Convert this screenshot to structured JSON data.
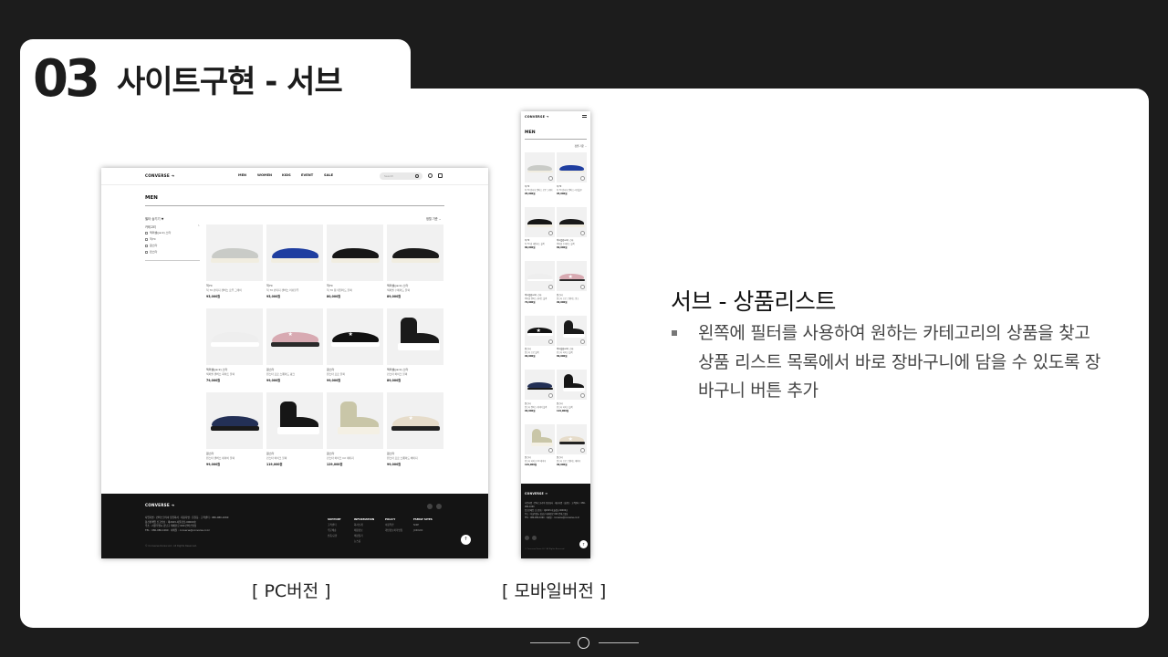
{
  "slide": {
    "number": "03",
    "title": "사이트구현 - 서브"
  },
  "pc": {
    "logo": "CONVERSE ➔",
    "nav": [
      "MEN",
      "WOMEN",
      "KIDS",
      "EVENT",
      "SALE"
    ],
    "search_placeholder": "Search",
    "page_title": "MEN",
    "filter_label": "필터 숨기기 ▼",
    "filter_category": "카테고리",
    "filter_options": [
      "잭퍼셀(Jack) 스타",
      "척70",
      "원스타",
      "런스타"
    ],
    "sort_label": "정렬 기준 ⌄",
    "products": [
      {
        "category": "척70",
        "name": "척 70 빈티지 캔버스 로우 그레이",
        "price": "95,000원",
        "shoe": "low",
        "color": "#c9cbc7",
        "sole": "#f1ede0"
      },
      {
        "category": "척70",
        "name": "척 70 빈티지 캔버스 러쉬블루",
        "price": "95,000원",
        "shoe": "low",
        "color": "#1f3ea0",
        "sole": "#f1ede0"
      },
      {
        "category": "척70",
        "name": "척 70 웜 테일러드 블랙",
        "price": "80,000원",
        "shoe": "low",
        "color": "#161616",
        "sole": "#f1ede0"
      },
      {
        "category": "잭퍼셀(Jack) 스타",
        "name": "잭퍼셀 수에이드 블랙",
        "price": "89,000원",
        "shoe": "low",
        "color": "#1a1a1a",
        "sole": "#f1ede0"
      },
      {
        "category": "잭퍼셀(Jack) 스타",
        "name": "잭퍼셀 캔버스 화이트 블랙",
        "price": "79,000원",
        "shoe": "low",
        "color": "#eeeeee",
        "sole": "#ffffff"
      },
      {
        "category": "원스타",
        "name": "원스타 프로 스웨이드 핑크",
        "price": "99,000원",
        "shoe": "star",
        "color": "#d8aab2",
        "sole": "#2a2a2a"
      },
      {
        "category": "원스타",
        "name": "원스타 프로 블랙",
        "price": "99,000원",
        "shoe": "star",
        "color": "#111111",
        "sole": "#ffffff"
      },
      {
        "category": "잭퍼셀(Jack) 스타",
        "name": "런스타 하이크 블랙",
        "price": "89,000원",
        "shoe": "high",
        "color": "#1a1a1a",
        "sole": "#ffffff"
      },
      {
        "category": "원스타",
        "name": "원스타 캔버스 네이비 블랙",
        "price": "99,000원",
        "shoe": "low",
        "color": "#233056",
        "sole": "#1a1a1a"
      },
      {
        "category": "원스타",
        "name": "런스타 하이크 블랙",
        "price": "119,000원",
        "shoe": "high",
        "color": "#161616",
        "sole": "#ffffff"
      },
      {
        "category": "원스타",
        "name": "런스타 하이크 CX 세이지",
        "price": "129,000원",
        "shoe": "high",
        "color": "#c9c6a8",
        "sole": "#f4f0e4"
      },
      {
        "category": "원스타",
        "name": "원스타 프로 스웨이드 베이지",
        "price": "99,000원",
        "shoe": "star",
        "color": "#e6dcca",
        "sole": "#222222"
      }
    ],
    "footer": {
      "logo": "CONVERSE ➔",
      "info_lines": [
        "사업자명 : 컨버스코리아 유한회사 · 대표자명 : 홍길동 · 고객센터 : 080-080-1060",
        "통신판매업 신고번호 : 제2023-서울강남-00000호",
        "주소 : 서울특별시 강남구 테헤란로 000 컨버스빌딩",
        "TEL : 080-080-1060 · 이메일 : converse@converse.co.kr"
      ],
      "copyright": "© Converse Korea LLC. All Rights Reserved.",
      "columns": [
        {
          "title": "SUPPORT",
          "items": [
            "고객센터",
            "주문배송",
            "반품/교환"
          ]
        },
        {
          "title": "INFORMATION",
          "items": [
            "회사소개",
            "채용정보",
            "매장찾기",
            "뉴스룸"
          ]
        },
        {
          "title": "POLICY",
          "items": [
            "이용약관",
            "개인정보처리방침"
          ]
        },
        {
          "title": "FAMILY SITES",
          "items": [
            "NIKE",
            "JORDAN"
          ]
        }
      ]
    }
  },
  "mobile": {
    "logo": "CONVERSE ➔",
    "page_title": "MEN",
    "sort_label": "정렬 기준 ⌄",
    "footer_logo": "CONVERSE ➔"
  },
  "captions": {
    "pc": "[ PC버전 ]",
    "mobile": "[ 모바일버전 ]"
  },
  "description": {
    "title": "서브 - 상품리스트",
    "body": "왼쪽에 필터를 사용하여 원하는 카테고리의 상품을 찾고 상품 리스트 목록에서 바로 장바구니에 담을 수 있도록 장바구니 버튼 추가"
  }
}
